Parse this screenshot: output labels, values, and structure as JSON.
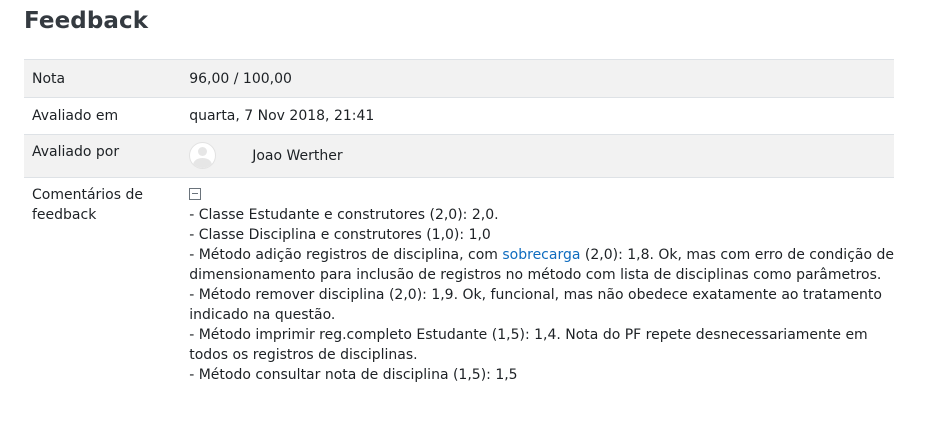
{
  "section": {
    "title": "Feedback"
  },
  "rows": {
    "grade": {
      "label": "Nota",
      "value": "96,00 / 100,00"
    },
    "graded_on": {
      "label": "Avaliado em",
      "value": "quarta, 7 Nov 2018, 21:41"
    },
    "graded_by": {
      "label": "Avaliado por",
      "value": "Joao Werther",
      "avatar_icon": "user-avatar-icon"
    },
    "comments": {
      "label": "Comentários de feedback",
      "collapse_icon": "collapse-icon",
      "lines": [
        {
          "text": "- Classe Estudante e construtores (2,0): 2,0."
        },
        {
          "text": "- Classe Disciplina e construtores (1,0): 1,0"
        },
        {
          "before": "- Método adição registros de disciplina, com ",
          "link": "sobrecarga",
          "after": " (2,0): 1,8. Ok, mas com erro de condição de"
        },
        {
          "text": "dimensionamento para inclusão de registros no método com lista de disciplinas como parâmetros."
        },
        {
          "text": "- Método remover disciplina (2,0): 1,9. Ok, funcional, mas não obedece exatamente ao tratamento"
        },
        {
          "text": "indicado na questão."
        },
        {
          "text": "- Método imprimir reg.completo Estudante (1,5): 1,4. Nota do PF repete desnecessariamente em"
        },
        {
          "text": "todos os registros de disciplinas."
        },
        {
          "text": "- Método consultar nota de disciplina (1,5): 1,5"
        }
      ]
    }
  },
  "colors": {
    "row_alt_background": "#f2f2f2",
    "border": "#dee2e6",
    "link": "#0f6cbf",
    "text": "#1d2125"
  }
}
